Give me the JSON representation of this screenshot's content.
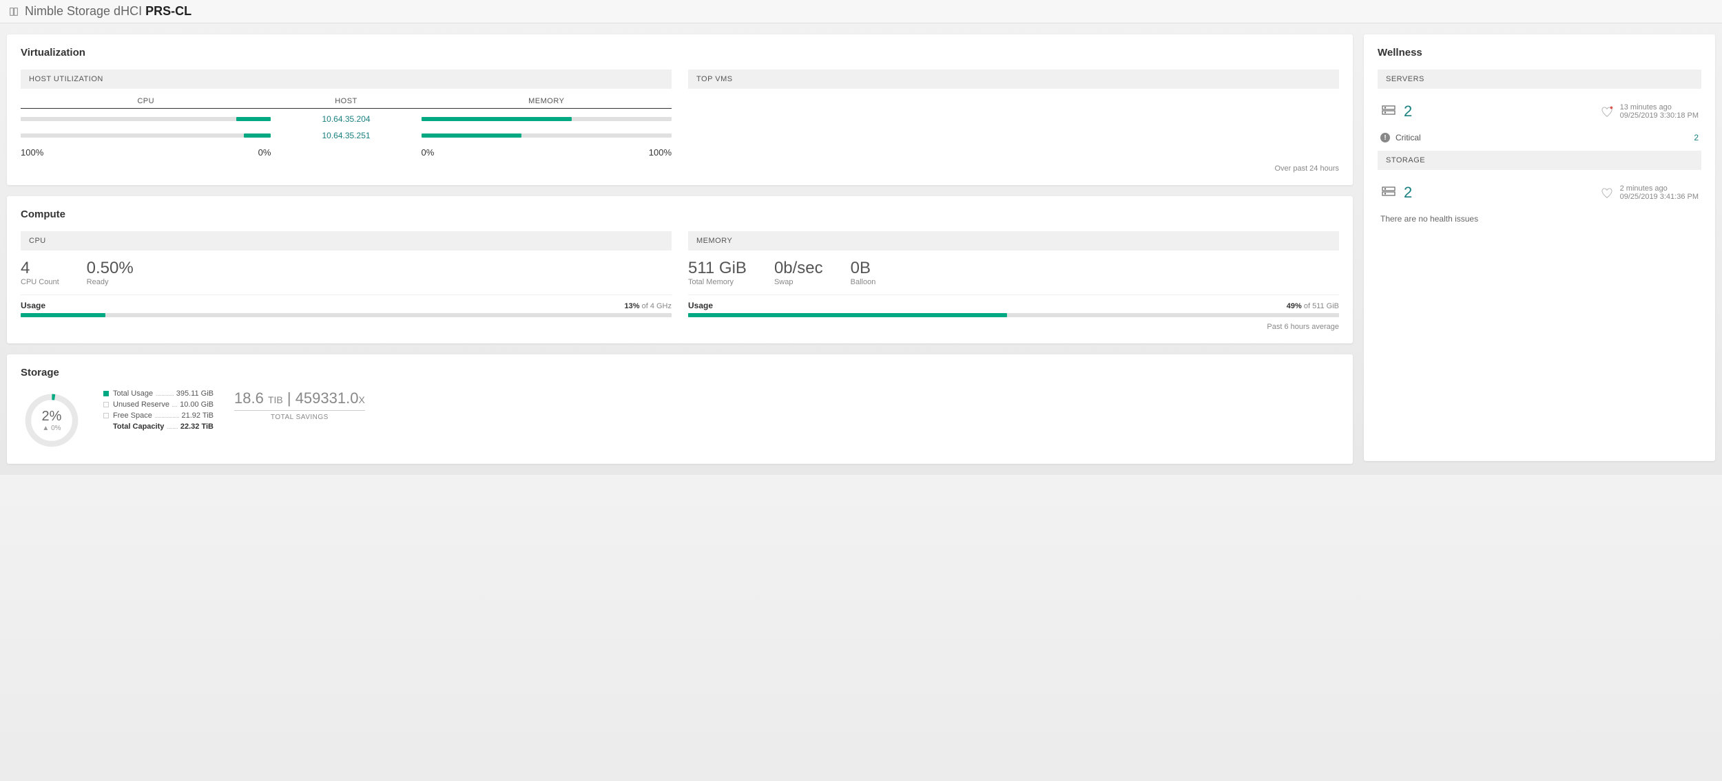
{
  "header": {
    "product": "Nimble Storage dHCI",
    "instance": "PRS-CL"
  },
  "virtualization": {
    "title": "Virtualization",
    "host_util_label": "HOST UTILIZATION",
    "top_vms_label": "TOP VMS",
    "columns": {
      "cpu": "CPU",
      "host": "HOST",
      "memory": "MEMORY"
    },
    "hosts": [
      {
        "host": "10.64.35.204",
        "cpu_pct": 14,
        "mem_pct": 60
      },
      {
        "host": "10.64.35.251",
        "cpu_pct": 11,
        "mem_pct": 40
      }
    ],
    "scale": {
      "cpu_left": "100%",
      "cpu_right": "0%",
      "mem_left": "0%",
      "mem_right": "100%"
    },
    "footnote": "Over past 24 hours"
  },
  "compute": {
    "title": "Compute",
    "cpu": {
      "label": "CPU",
      "count_val": "4",
      "count_lab": "CPU Count",
      "ready_val": "0.50%",
      "ready_lab": "Ready",
      "usage_label": "Usage",
      "usage_pct": 13,
      "usage_pct_text": "13%",
      "usage_of": " of 4 GHz"
    },
    "memory": {
      "label": "MEMORY",
      "total_val": "511 GiB",
      "total_lab": "Total Memory",
      "swap_val": "0b/sec",
      "swap_lab": "Swap",
      "balloon_val": "0B",
      "balloon_lab": "Balloon",
      "usage_label": "Usage",
      "usage_pct": 49,
      "usage_pct_text": "49%",
      "usage_of": " of 511 GiB"
    },
    "footnote": "Past 6 hours average"
  },
  "storage": {
    "title": "Storage",
    "donut_pct": "2%",
    "donut_delta": "▲ 0%",
    "legend": [
      {
        "label": "Total Usage",
        "value": "395.11 GiB",
        "color": "#01a982"
      },
      {
        "label": "Unused Reserve",
        "value": "10.00 GiB",
        "color": "#ffffff"
      },
      {
        "label": "Free Space",
        "value": "21.92 TiB",
        "color": "#ffffff"
      }
    ],
    "total_capacity_label": "Total Capacity",
    "total_capacity_value": "22.32 TiB",
    "savings_value": "18.6",
    "savings_unit": "TIB",
    "savings_sep": " | ",
    "savings_ratio": "459331.0",
    "savings_x": "X",
    "savings_label": "TOTAL SAVINGS"
  },
  "wellness": {
    "title": "Wellness",
    "servers": {
      "label": "SERVERS",
      "count": "2",
      "ago": "13 minutes ago",
      "timestamp": "09/25/2019 3:30:18 PM",
      "critical_label": "Critical",
      "critical_count": "2"
    },
    "storage": {
      "label": "STORAGE",
      "count": "2",
      "ago": "2 minutes ago",
      "timestamp": "09/25/2019 3:41:36 PM",
      "no_issues": "There are no health issues"
    }
  },
  "chart_data": [
    {
      "type": "bar",
      "title": "Host Utilization",
      "orientation": "horizontal",
      "categories": [
        "10.64.35.204",
        "10.64.35.251"
      ],
      "series": [
        {
          "name": "CPU %",
          "values": [
            14,
            11
          ]
        },
        {
          "name": "Memory %",
          "values": [
            60,
            40
          ]
        }
      ],
      "xlim": [
        0,
        100
      ]
    },
    {
      "type": "bar",
      "title": "Compute CPU Usage",
      "categories": [
        "CPU Usage"
      ],
      "values": [
        13
      ],
      "ylabel": "% of 4 GHz",
      "ylim": [
        0,
        100
      ]
    },
    {
      "type": "bar",
      "title": "Compute Memory Usage",
      "categories": [
        "Memory Usage"
      ],
      "values": [
        49
      ],
      "ylabel": "% of 511 GiB",
      "ylim": [
        0,
        100
      ]
    },
    {
      "type": "pie",
      "title": "Storage Capacity",
      "categories": [
        "Total Usage (GiB)",
        "Unused Reserve (GiB)",
        "Free Space (TiB→GiB)"
      ],
      "values": [
        395.11,
        10.0,
        22446.08
      ],
      "annotations": [
        "2% used",
        "Total Capacity 22.32 TiB"
      ]
    }
  ]
}
